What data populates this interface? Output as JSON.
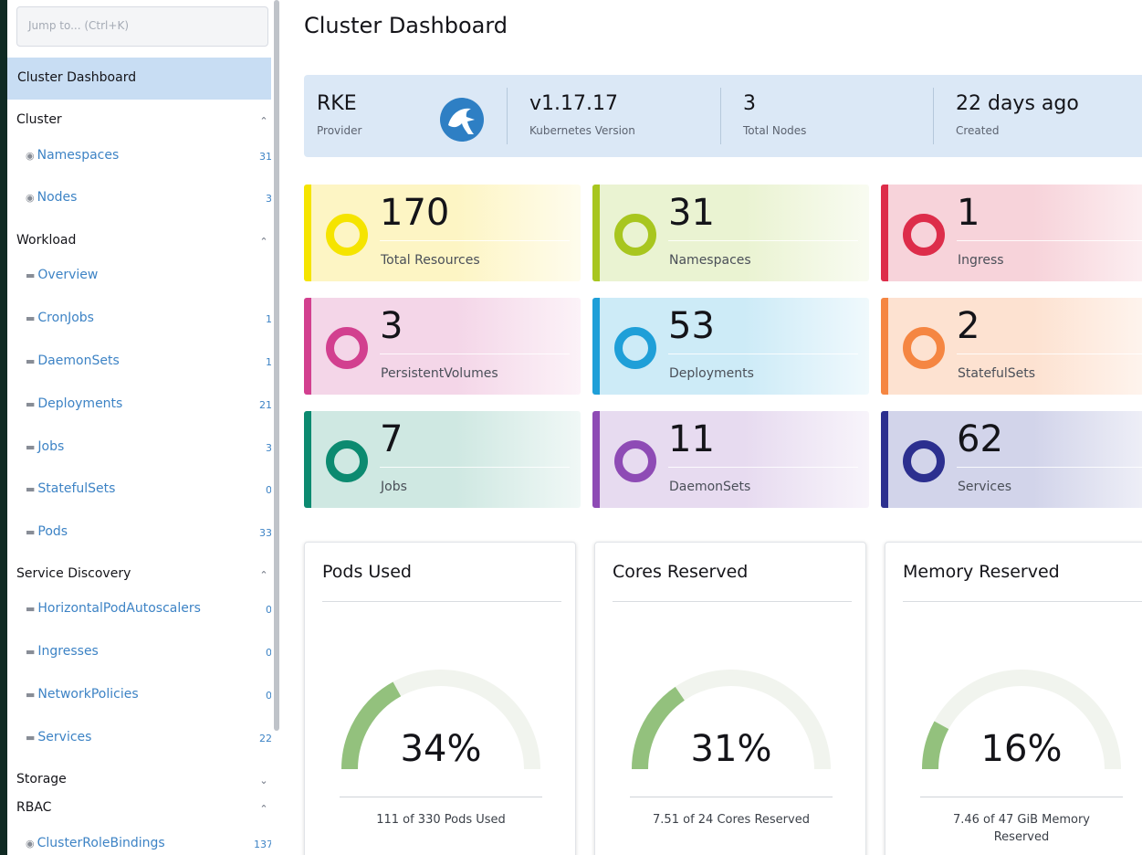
{
  "sidebar": {
    "jump_placeholder": "Jump to... (Ctrl+K)",
    "active_item": "Cluster Dashboard",
    "groups": [
      {
        "label": "Cluster",
        "chevron": "^"
      },
      {
        "label": "Workload",
        "chevron": "^"
      },
      {
        "label": "Service Discovery",
        "chevron": "^"
      },
      {
        "label": "Storage",
        "chevron": "v"
      },
      {
        "label": "RBAC",
        "chevron": "^"
      }
    ],
    "items": [
      {
        "label": "Namespaces",
        "count": "31",
        "icon": "globe-icon"
      },
      {
        "label": "Nodes",
        "count": "3",
        "icon": "globe-icon"
      },
      {
        "label": "Overview",
        "count": "",
        "icon": "folder-icon"
      },
      {
        "label": "CronJobs",
        "count": "1",
        "icon": "folder-icon"
      },
      {
        "label": "DaemonSets",
        "count": "1",
        "icon": "folder-icon"
      },
      {
        "label": "Deployments",
        "count": "21",
        "icon": "folder-icon"
      },
      {
        "label": "Jobs",
        "count": "3",
        "icon": "folder-icon"
      },
      {
        "label": "StatefulSets",
        "count": "0",
        "icon": "folder-icon"
      },
      {
        "label": "Pods",
        "count": "33",
        "icon": "folder-icon"
      },
      {
        "label": "HorizontalPodAutoscalers",
        "count": "0",
        "icon": "folder-icon"
      },
      {
        "label": "Ingresses",
        "count": "0",
        "icon": "folder-icon"
      },
      {
        "label": "NetworkPolicies",
        "count": "0",
        "icon": "folder-icon"
      },
      {
        "label": "Services",
        "count": "22",
        "icon": "folder-icon"
      },
      {
        "label": "ClusterRoleBindings",
        "count": "137",
        "icon": "globe-icon"
      }
    ]
  },
  "header": {
    "title": "Cluster Dashboard"
  },
  "info": {
    "provider_value": "RKE",
    "provider_label": "Provider",
    "version_value": "v1.17.17",
    "version_label": "Kubernetes Version",
    "nodes_value": "3",
    "nodes_label": "Total Nodes",
    "created_value": "22 days ago",
    "created_label": "Created"
  },
  "resources": [
    {
      "value": "170",
      "label": "Total Resources",
      "color": "#f5e400",
      "bg": "#fdf5c4"
    },
    {
      "value": "31",
      "label": "Namespaces",
      "color": "#a8c61f",
      "bg": "#eaf3d2"
    },
    {
      "value": "1",
      "label": "Ingress",
      "color": "#dd2d4a",
      "bg": "#f7d3da"
    },
    {
      "value": "3",
      "label": "PersistentVolumes",
      "color": "#d2408f",
      "bg": "#f4d6e8"
    },
    {
      "value": "53",
      "label": "Deployments",
      "color": "#1f9fd8",
      "bg": "#cdebf7"
    },
    {
      "value": "2",
      "label": "StatefulSets",
      "color": "#f58642",
      "bg": "#fde2d1"
    },
    {
      "value": "7",
      "label": "Jobs",
      "color": "#0c8a70",
      "bg": "#cfe8e2"
    },
    {
      "value": "11",
      "label": "DaemonSets",
      "color": "#8e4bb5",
      "bg": "#e7dbf0"
    },
    {
      "value": "62",
      "label": "Services",
      "color": "#2c2f8f",
      "bg": "#d2d4ea"
    }
  ],
  "gauges": [
    {
      "title": "Pods Used",
      "percent": "34%",
      "fraction": 0.34,
      "sub": "111 of 330 Pods Used"
    },
    {
      "title": "Cores Reserved",
      "percent": "31%",
      "fraction": 0.31,
      "sub": "7.51 of 24 Cores Reserved"
    },
    {
      "title": "Memory Reserved",
      "percent": "16%",
      "fraction": 0.16,
      "sub": "7.46 of 47 GiB Memory Reserved"
    }
  ],
  "colors": {
    "gauge_fill": "#93c17d",
    "gauge_track": "#f1f4ee",
    "link": "#3d83c5",
    "active_bg": "#c8ddf3"
  }
}
